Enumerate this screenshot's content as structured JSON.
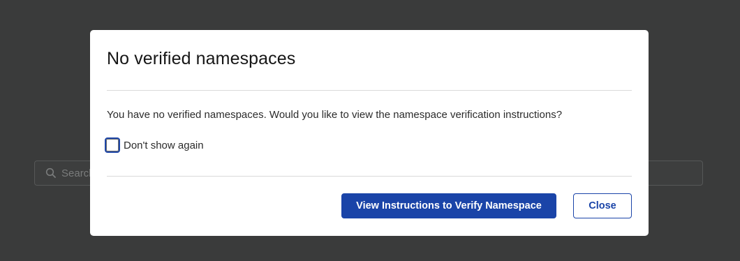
{
  "background": {
    "search": {
      "placeholder": "Search"
    }
  },
  "modal": {
    "title": "No verified namespaces",
    "message": "You have no verified namespaces. Would you like to view the namespace verification instructions?",
    "checkbox": {
      "label": "Don't show again",
      "checked": false
    },
    "buttons": {
      "primary_label": "View Instructions to Verify Namespace",
      "secondary_label": "Close"
    }
  },
  "colors": {
    "overlay": "#3a3b3b",
    "primary": "#1a44a8",
    "modal_bg": "#ffffff"
  },
  "icons": {
    "search": "search-icon"
  }
}
